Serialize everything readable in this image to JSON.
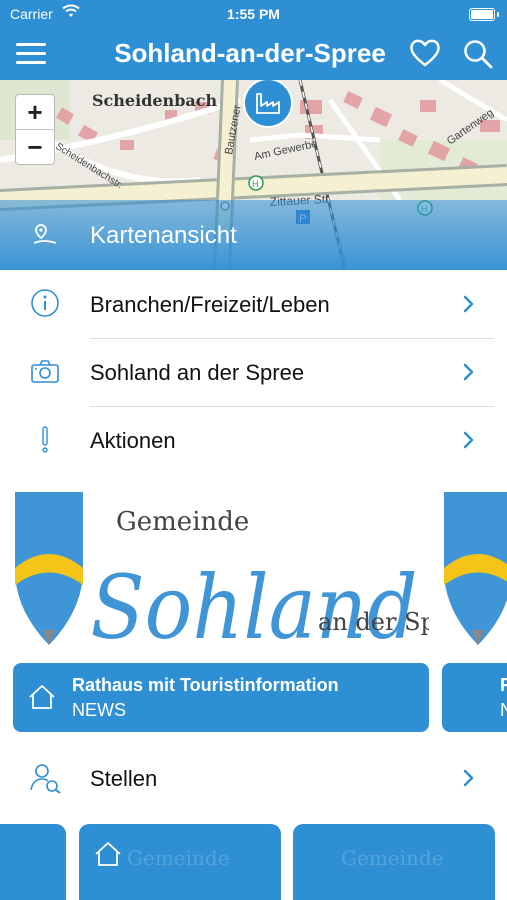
{
  "status_bar": {
    "carrier": "Carrier",
    "time": "1:55 PM"
  },
  "navbar": {
    "title": "Sohland-an-der-Spree"
  },
  "map": {
    "label": "Kartenansicht",
    "zoom_in": "+",
    "zoom_out": "−",
    "streets": {
      "scheidenbach": "Scheidenbach",
      "scheidenbachstr": "Scheidenbachstr.",
      "bautzener": "Bautzener",
      "zittauer": "Zittauer Str.",
      "am_gewerbe": "Am Gewerbe",
      "gartenweg": "Gartenweg"
    }
  },
  "menu": [
    {
      "label": "Branchen/Freizeit/Leben",
      "icon": "info-icon"
    },
    {
      "label": "Sohland an der Spree",
      "icon": "camera-icon"
    },
    {
      "label": "Aktionen",
      "icon": "exclamation-icon"
    }
  ],
  "banner": {
    "logo_line1": "Gemeinde",
    "logo_line2": "Sohland",
    "logo_line3": "an der Spree",
    "title": "Rathaus mit Touristinformation",
    "subtitle": "NEWS",
    "next_title_initial": "R",
    "next_subtitle_initial": "N"
  },
  "stellen": {
    "label": "Stellen",
    "icon": "people-search-icon"
  },
  "tiles_faint": "Gemeinde",
  "colors": {
    "accent": "#2f8fd4",
    "chevron": "#2f8fd4",
    "icon": "#2f8fd4"
  }
}
